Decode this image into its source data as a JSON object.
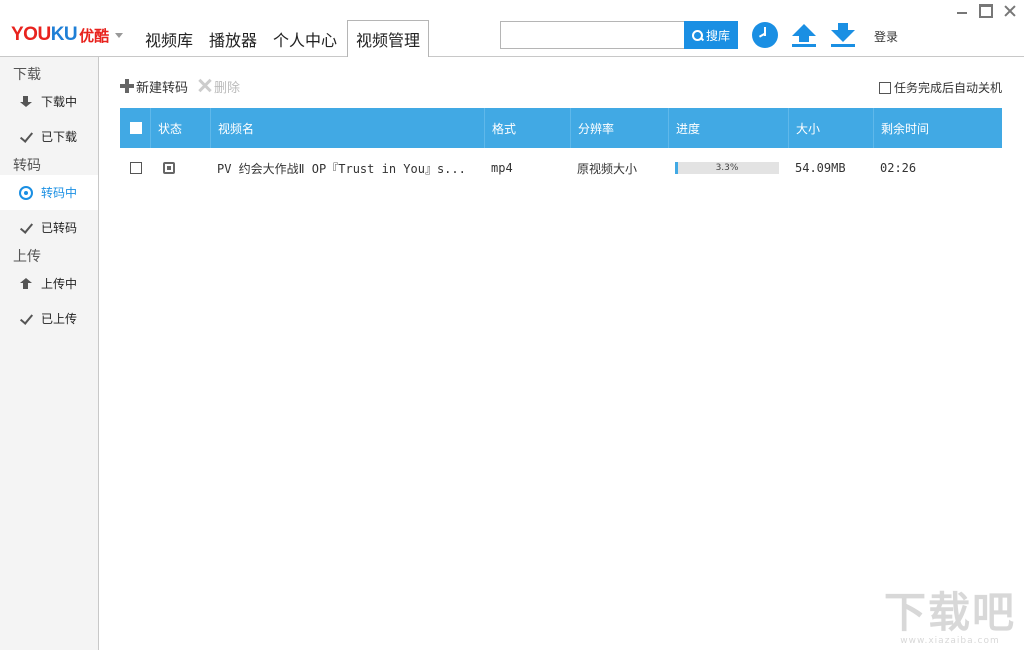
{
  "app": {
    "logo_text_red": "YOU",
    "logo_text_blue": "KU",
    "logo_cn": "优酷"
  },
  "nav": {
    "tabs": [
      {
        "label": "视频库"
      },
      {
        "label": "播放器"
      },
      {
        "label": "个人中心"
      },
      {
        "label": "视频管理",
        "active": true
      }
    ]
  },
  "search": {
    "value": "",
    "placeholder": "",
    "button_label": "搜库"
  },
  "header": {
    "login_label": "登录",
    "icons": [
      "clock-icon",
      "upload-icon",
      "download-icon"
    ]
  },
  "sidebar": {
    "groups": [
      {
        "title": "下载",
        "items": [
          {
            "label": "下载中",
            "icon": "download-arrow-icon"
          },
          {
            "label": "已下载",
            "icon": "check-icon"
          }
        ]
      },
      {
        "title": "转码",
        "items": [
          {
            "label": "转码中",
            "icon": "converting-icon",
            "active": true
          },
          {
            "label": "已转码",
            "icon": "check-icon"
          }
        ]
      },
      {
        "title": "上传",
        "items": [
          {
            "label": "上传中",
            "icon": "upload-arrow-icon"
          },
          {
            "label": "已上传",
            "icon": "check-icon"
          }
        ]
      }
    ]
  },
  "toolbar": {
    "new_label": "新建转码",
    "delete_label": "删除",
    "auto_shutdown_label": "任务完成后自动关机"
  },
  "table": {
    "headers": [
      "状态",
      "视频名",
      "格式",
      "分辨率",
      "进度",
      "大小",
      "剩余时间"
    ],
    "rows": [
      {
        "name": "PV 约会大作战Ⅱ OP『Trust in You』s...",
        "format": "mp4",
        "resolution": "原视频大小",
        "progress": 3.3,
        "progress_text": "3.3%",
        "size": "54.09MB",
        "remaining": "02:26"
      }
    ]
  },
  "watermark": {
    "big": "下载吧",
    "small": "www.xiazaiba.com"
  },
  "colors": {
    "accent": "#1a8fe3",
    "table_header": "#41a9e4",
    "logo_red": "#e8231e",
    "logo_blue": "#1f7fd6"
  }
}
